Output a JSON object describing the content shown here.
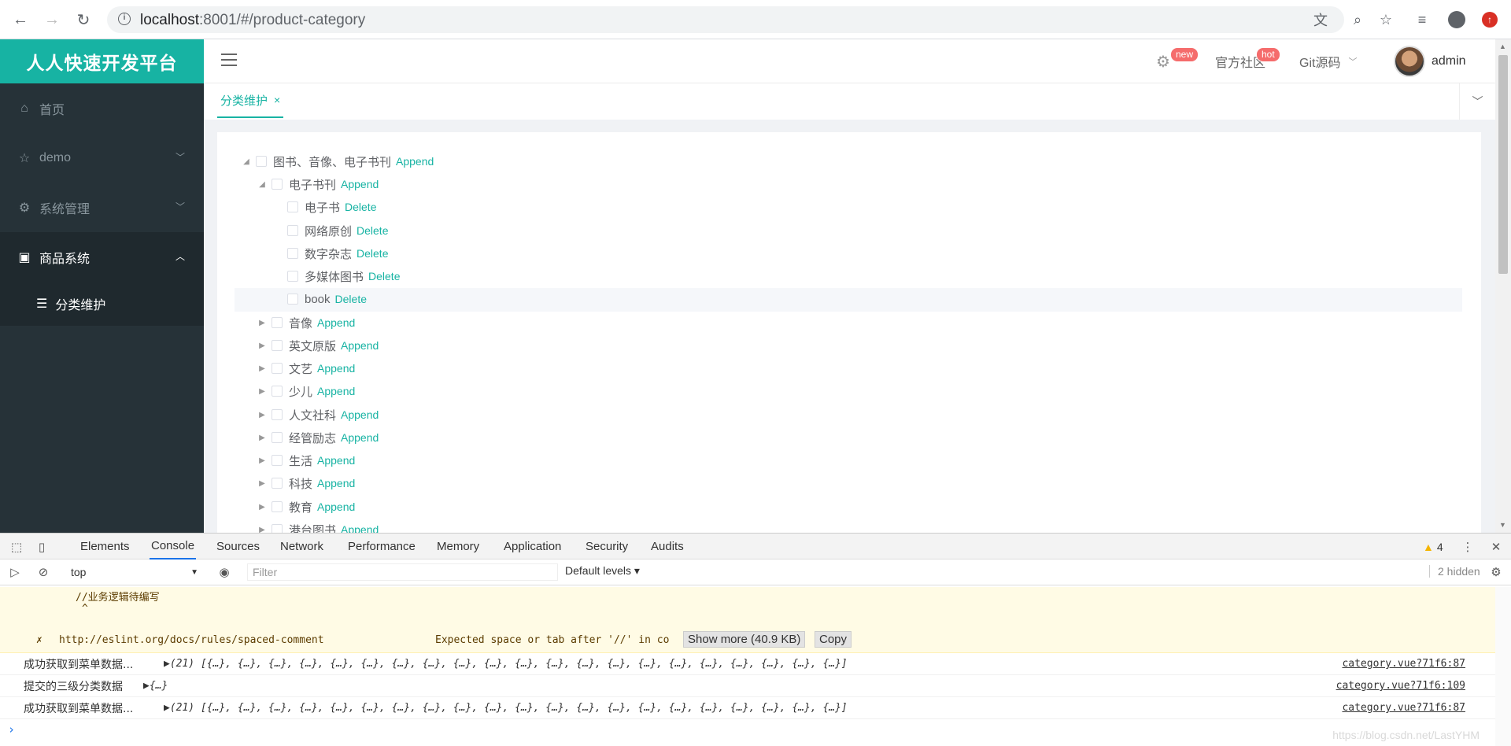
{
  "browser": {
    "url_host": "localhost",
    "url_rest": ":8001/#/product-category",
    "icons": [
      "back-icon",
      "forward-icon",
      "reload-icon",
      "info-icon",
      "translate-icon",
      "zoom-icon",
      "star-icon",
      "media-icon",
      "account-icon",
      "update-icon"
    ]
  },
  "brand": "人人快速开发平台",
  "sidebar": {
    "items": [
      {
        "label": "首页",
        "icon": "home-icon"
      },
      {
        "label": "demo",
        "icon": "star-icon"
      },
      {
        "label": "系统管理",
        "icon": "gear-icon"
      },
      {
        "label": "商品系统",
        "icon": "product-icon"
      }
    ],
    "submenu": {
      "label": "分类维护",
      "icon": "list-icon"
    }
  },
  "navbar": {
    "badge_new": "new",
    "community": "官方社区",
    "badge_hot": "hot",
    "git": "Git源码",
    "user": "admin"
  },
  "tabs": {
    "active": "分类维护",
    "close": "×"
  },
  "tree": {
    "root": {
      "label": "图书、音像、电子书刊",
      "action": "Append"
    },
    "level2_open": {
      "label": "电子书刊",
      "action": "Append"
    },
    "children": [
      {
        "label": "电子书",
        "action": "Delete"
      },
      {
        "label": "网络原创",
        "action": "Delete"
      },
      {
        "label": "数字杂志",
        "action": "Delete"
      },
      {
        "label": "多媒体图书",
        "action": "Delete"
      },
      {
        "label": "book",
        "action": "Delete"
      }
    ],
    "siblings": [
      {
        "label": "音像",
        "action": "Append"
      },
      {
        "label": "英文原版",
        "action": "Append"
      },
      {
        "label": "文艺",
        "action": "Append"
      },
      {
        "label": "少儿",
        "action": "Append"
      },
      {
        "label": "人文社科",
        "action": "Append"
      },
      {
        "label": "经管励志",
        "action": "Append"
      },
      {
        "label": "生活",
        "action": "Append"
      },
      {
        "label": "科技",
        "action": "Append"
      },
      {
        "label": "教育",
        "action": "Append"
      },
      {
        "label": "港台图书",
        "action": "Append"
      }
    ]
  },
  "devtools": {
    "tabs": [
      "Elements",
      "Console",
      "Sources",
      "Network",
      "Performance",
      "Memory",
      "Application",
      "Security",
      "Audits"
    ],
    "active_tab": "Console",
    "warning_count": "4",
    "context": "top",
    "filter_placeholder": "Filter",
    "levels": "Default levels ▾",
    "hidden": "2 hidden",
    "warn_line1": "//业务逻辑待编写",
    "warn_line2": "^",
    "warn_url": "http://eslint.org/docs/rules/spaced-comment",
    "warn_msg": "Expected space or tab after '//' in co",
    "show_more": "Show more (40.9 KB)",
    "copy": "Copy",
    "logs": [
      {
        "msg": "成功获取到菜单数据...",
        "obj": "▶(21) [{…}, {…}, {…}, {…}, {…}, {…}, {…}, {…}, {…}, {…}, {…}, {…}, {…}, {…}, {…}, {…}, {…}, {…}, {…}, {…}, {…}]",
        "src": "category.vue?71f6:87"
      },
      {
        "msg": "提交的三级分类数据",
        "obj": "▶{…}",
        "src": "category.vue?71f6:109"
      },
      {
        "msg": "成功获取到菜单数据...",
        "obj": "▶(21) [{…}, {…}, {…}, {…}, {…}, {…}, {…}, {…}, {…}, {…}, {…}, {…}, {…}, {…}, {…}, {…}, {…}, {…}, {…}, {…}, {…}]",
        "src": "category.vue?71f6:87"
      }
    ],
    "prompt": "›",
    "watermark": "https://blog.csdn.net/LastYHM"
  },
  "colors": {
    "accent": "#17b3a3",
    "sidebar": "#263238",
    "badge": "#f56c6c"
  }
}
